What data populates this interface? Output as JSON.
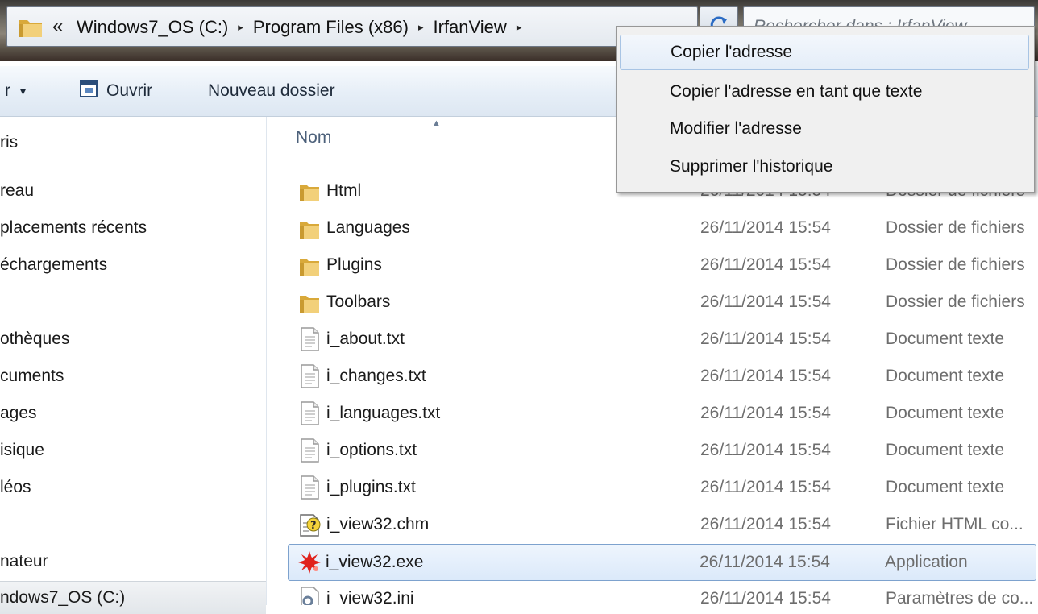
{
  "address_bar": {
    "overflow_glyph": "«",
    "crumbs": [
      "Windows7_OS (C:)",
      "Program Files (x86)",
      "IrfanView"
    ],
    "separator_glyph": "▸",
    "dropdown_glyph": "▾",
    "search_placeholder": "Rechercher dans : IrfanView"
  },
  "toolbar": {
    "organize_fragment": "r",
    "dropdown_glyph": "▾",
    "open_label": "Ouvrir",
    "new_folder_label": "Nouveau dossier"
  },
  "nav": {
    "items": [
      {
        "label": "ris"
      },
      {
        "label": "reau"
      },
      {
        "label": "placements récents"
      },
      {
        "label": "échargements"
      },
      {
        "label": "othèques"
      },
      {
        "label": "cuments"
      },
      {
        "label": "ages"
      },
      {
        "label": "isique"
      },
      {
        "label": "léos"
      },
      {
        "label": "nateur"
      },
      {
        "label": "ndows7_OS (C:)"
      }
    ]
  },
  "list": {
    "column_name": "Nom",
    "sort_glyph": "▲",
    "rows": [
      {
        "name": "Html",
        "date": "26/11/2014 15:54",
        "type": "Dossier de fichiers",
        "icon": "folder-icon"
      },
      {
        "name": "Languages",
        "date": "26/11/2014 15:54",
        "type": "Dossier de fichiers",
        "icon": "folder-icon"
      },
      {
        "name": "Plugins",
        "date": "26/11/2014 15:54",
        "type": "Dossier de fichiers",
        "icon": "folder-icon"
      },
      {
        "name": "Toolbars",
        "date": "26/11/2014 15:54",
        "type": "Dossier de fichiers",
        "icon": "folder-icon"
      },
      {
        "name": "i_about.txt",
        "date": "26/11/2014 15:54",
        "type": "Document texte",
        "icon": "text-file-icon"
      },
      {
        "name": "i_changes.txt",
        "date": "26/11/2014 15:54",
        "type": "Document texte",
        "icon": "text-file-icon"
      },
      {
        "name": "i_languages.txt",
        "date": "26/11/2014 15:54",
        "type": "Document texte",
        "icon": "text-file-icon"
      },
      {
        "name": "i_options.txt",
        "date": "26/11/2014 15:54",
        "type": "Document texte",
        "icon": "text-file-icon"
      },
      {
        "name": "i_plugins.txt",
        "date": "26/11/2014 15:54",
        "type": "Document texte",
        "icon": "text-file-icon"
      },
      {
        "name": "i_view32.chm",
        "date": "26/11/2014 15:54",
        "type": "Fichier HTML co...",
        "icon": "help-file-icon"
      },
      {
        "name": "i_view32.exe",
        "date": "26/11/2014 15:54",
        "type": "Application",
        "icon": "irfanview-app-icon"
      },
      {
        "name": "i_view32.ini",
        "date": "26/11/2014 15:54",
        "type": "Paramètres de co...",
        "icon": "settings-file-icon"
      }
    ]
  },
  "context_menu": {
    "items": [
      {
        "label": "Copier l'adresse"
      },
      {
        "label": "Copier l'adresse en tant que texte"
      },
      {
        "label": "Modifier l'adresse"
      },
      {
        "label": "Supprimer l'historique"
      }
    ]
  },
  "colors": {
    "selection_border": "#7da2ce",
    "header_text": "#4c607a",
    "folder_yellow": "#e8c15a"
  }
}
